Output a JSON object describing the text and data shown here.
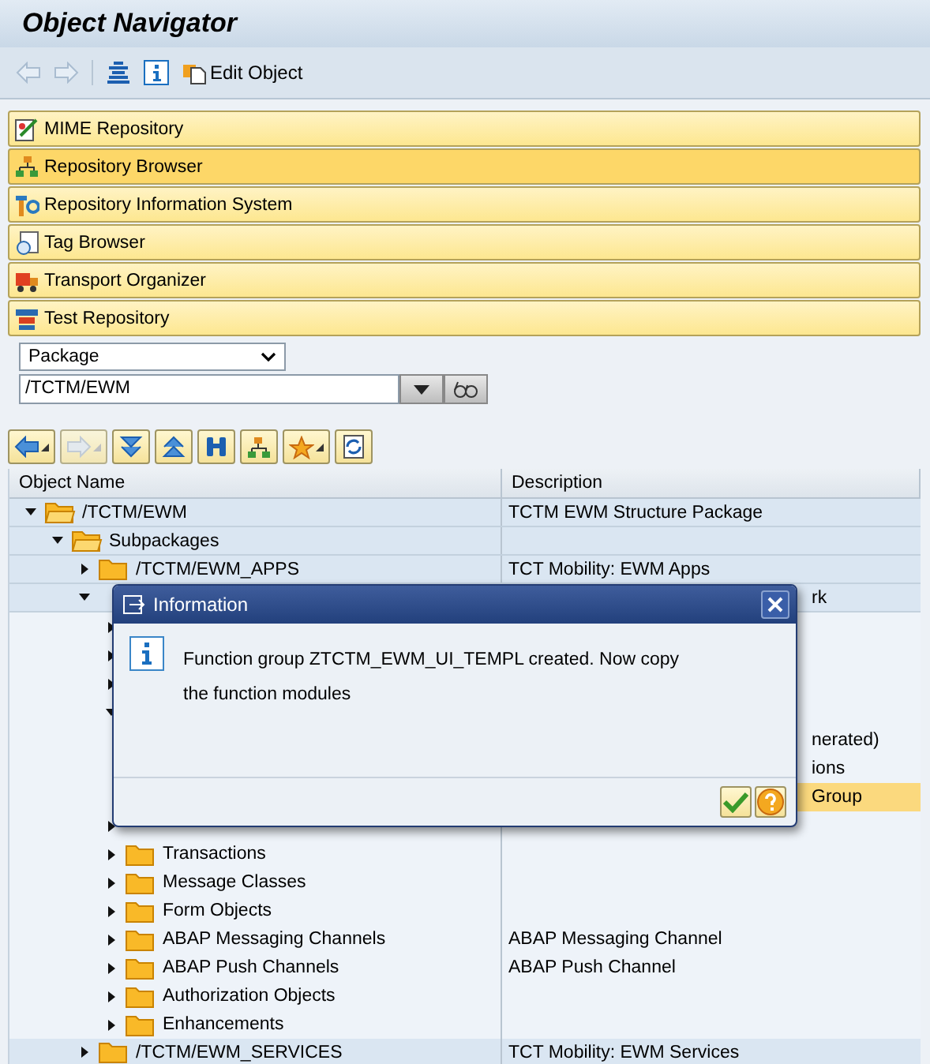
{
  "window": {
    "title": "Object Navigator"
  },
  "toolbar": {
    "edit_button": "Edit Object"
  },
  "panels": [
    {
      "label": "MIME Repository",
      "selected": false
    },
    {
      "label": "Repository Browser",
      "selected": true
    },
    {
      "label": "Repository Information System",
      "selected": false
    },
    {
      "label": "Tag Browser",
      "selected": false
    },
    {
      "label": "Transport Organizer",
      "selected": false
    },
    {
      "label": "Test Repository",
      "selected": false
    }
  ],
  "object_type": {
    "value": "Package"
  },
  "object_name": {
    "value": "/TCTM/EWM"
  },
  "tree": {
    "columns": [
      "Object Name",
      "Description"
    ],
    "rows": [
      {
        "name": "/TCTM/EWM",
        "description": "TCTM EWM Structure Package",
        "expanded": true,
        "children": [
          {
            "name": "Subpackages",
            "expanded": true,
            "children": [
              {
                "name": "/TCTM/EWM_APPS",
                "description": "TCT Mobility: EWM Apps",
                "expanded": false
              },
              {
                "description": "rk",
                "covered": true,
                "expanded": true,
                "children": [
                  {
                    "expanded": false
                  },
                  {
                    "expanded": false
                  },
                  {
                    "expanded": false
                  },
                  {
                    "expanded": true,
                    "children": [
                      {
                        "description": "nerated)",
                        "covered": true
                      },
                      {
                        "description": "ions",
                        "covered": true
                      },
                      {
                        "description": "Group",
                        "covered": true,
                        "selected": true
                      }
                    ]
                  },
                  {
                    "expanded": false
                  },
                  {
                    "name": "Transactions",
                    "expanded": false
                  },
                  {
                    "name": "Message Classes",
                    "expanded": false
                  },
                  {
                    "name": "Form Objects",
                    "expanded": false
                  },
                  {
                    "name": "ABAP Messaging Channels",
                    "description": "ABAP Messaging Channel",
                    "expanded": false
                  },
                  {
                    "name": "ABAP Push Channels",
                    "description": "ABAP Push Channel",
                    "expanded": false
                  },
                  {
                    "name": "Authorization Objects",
                    "expanded": false
                  },
                  {
                    "name": "Enhancements",
                    "expanded": false
                  }
                ]
              },
              {
                "name": "/TCTM/EWM_SERVICES",
                "description": "TCT Mobility: EWM Services",
                "expanded": false
              }
            ]
          }
        ]
      }
    ]
  },
  "dialog": {
    "title": "Information",
    "message": "Function group ZTCTM_EWM_UI_TEMPL created. Now copy the function modules"
  }
}
